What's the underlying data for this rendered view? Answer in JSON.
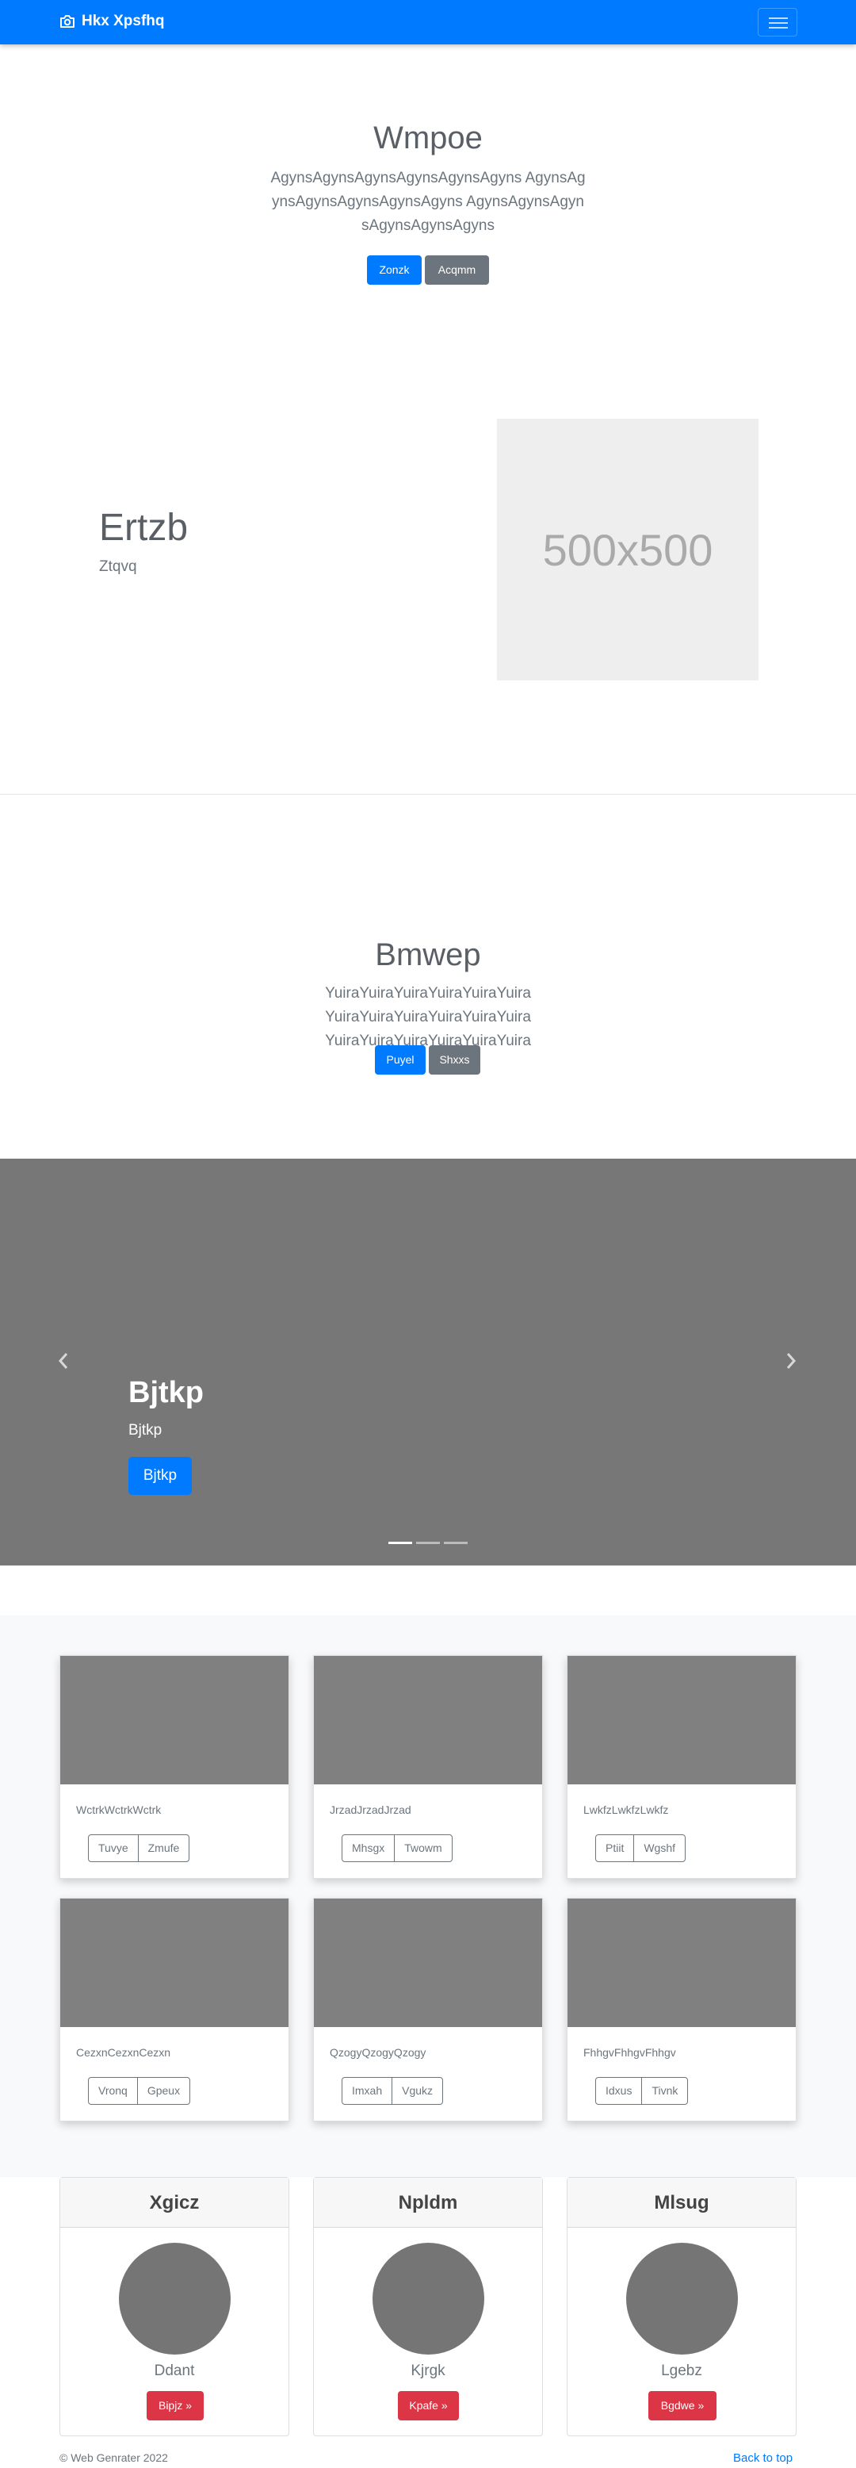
{
  "navbar": {
    "brand": "Hkx Xpsfhq",
    "brand_icon": "camera-icon",
    "toggler_icon": "hamburger-icon"
  },
  "hero1": {
    "title": "Wmpoe",
    "lead": "AgynsAgynsAgynsAgynsAgynsAgyns AgynsAgynsAgynsAgynsAgynsAgyns AgynsAgynsAgynsAgynsAgynsAgyns",
    "primary_label": "Zonzk",
    "secondary_label": "Acqmm"
  },
  "feature": {
    "heading": "Ertzb",
    "subheading": "Ztqvq",
    "placeholder_text": "500x500"
  },
  "hero2": {
    "title": "Bmwep",
    "lead": "YuiraYuiraYuiraYuiraYuiraYuira YuiraYuiraYuiraYuiraYuiraYuira YuiraYuiraYuiraYuiraYuiraYuira",
    "primary_label": "Puyel",
    "secondary_label": "Shxxs"
  },
  "carousel": {
    "title": "Bjtkp",
    "text": "Bjtkp",
    "button_label": "Bjtkp",
    "prev_icon": "chevron-left-icon",
    "next_icon": "chevron-right-icon",
    "slides": 3,
    "active_slide": 1
  },
  "album": {
    "cards": [
      {
        "text": "WctrkWctrkWctrk",
        "btn1": "Tuvye",
        "btn2": "Zmufe"
      },
      {
        "text": "JrzadJrzadJrzad",
        "btn1": "Mhsgx",
        "btn2": "Twowm"
      },
      {
        "text": "LwkfzLwkfzLwkfz",
        "btn1": "Ptiit",
        "btn2": "Wgshf"
      },
      {
        "text": "CezxnCezxnCezxn",
        "btn1": "Vronq",
        "btn2": "Gpeux"
      },
      {
        "text": "QzogyQzogyQzogy",
        "btn1": "Imxah",
        "btn2": "Vgukz"
      },
      {
        "text": "FhhgvFhhgvFhhgv",
        "btn1": "Idxus",
        "btn2": "Tivnk"
      }
    ]
  },
  "profiles": [
    {
      "header": "Xgicz",
      "name": "Ddant",
      "button": "Bipjz »"
    },
    {
      "header": "Npldm",
      "name": "Kjrgk",
      "button": "Kpafe »"
    },
    {
      "header": "Mlsug",
      "name": "Lgebz",
      "button": "Bgdwe »"
    }
  ],
  "footer": {
    "copyright": "© Web Genrater 2022",
    "back_to_top": "Back to top"
  }
}
